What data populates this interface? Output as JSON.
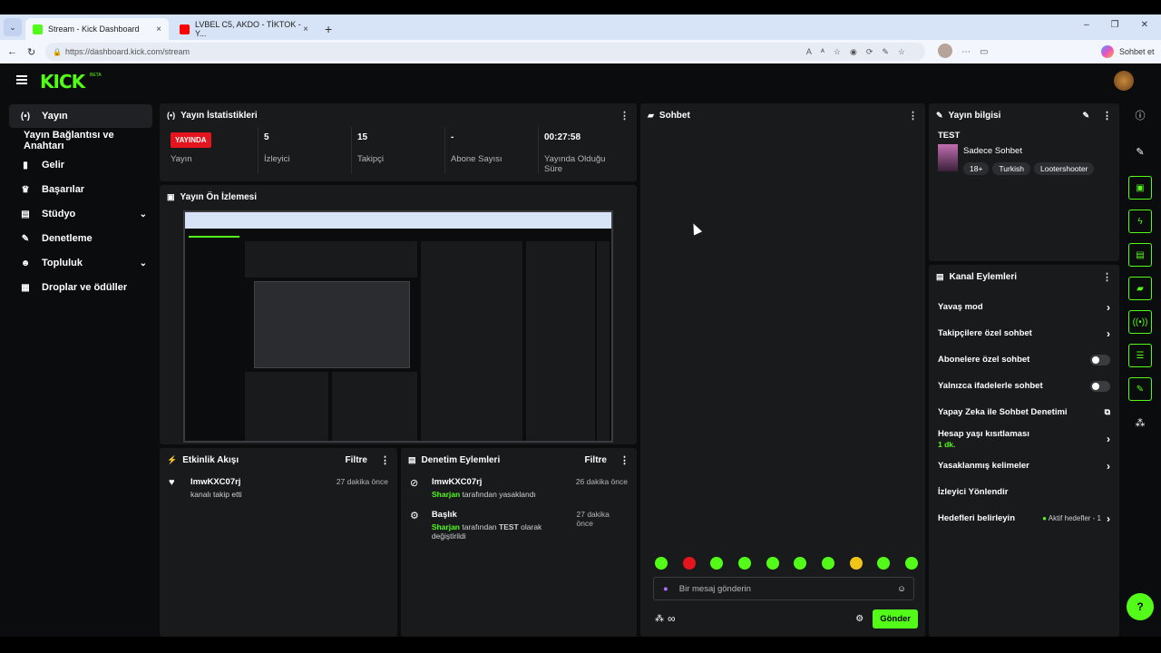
{
  "browser": {
    "tabs": [
      {
        "title": "Stream - Kick Dashboard",
        "close": "×"
      },
      {
        "title": "LVBEL C5, AKDO - TİKTOK - Y...",
        "close": "×"
      }
    ],
    "new_tab": "+",
    "url": "https://dashboard.kick.com/stream",
    "profile_label": "Sohbet et"
  },
  "app": {
    "logo": "KICK",
    "logo_badge": "BETA",
    "sidebar": [
      {
        "label": "Yayın",
        "icon": "live-icon"
      },
      {
        "label": "Yayın Bağlantısı ve Anahtarı",
        "icon": ""
      },
      {
        "label": "Gelir",
        "icon": "chart-icon"
      },
      {
        "label": "Başarılar",
        "icon": "trophy-icon"
      },
      {
        "label": "Stüdyo",
        "icon": "studio-icon",
        "expand": "⌄"
      },
      {
        "label": "Denetleme",
        "icon": "wrench-icon"
      },
      {
        "label": "Topluluk",
        "icon": "community-icon",
        "expand": "⌄"
      },
      {
        "label": "Droplar ve ödüller",
        "icon": "gift-icon"
      }
    ]
  },
  "stats": {
    "title": "Yayın İstatistikleri",
    "items": [
      {
        "value": "YAYINDA",
        "label": "Yayın"
      },
      {
        "value": "5",
        "label": "İzleyici"
      },
      {
        "value": "15",
        "label": "Takipçi"
      },
      {
        "value": "-",
        "label": "Abone Sayısı"
      },
      {
        "value": "00:27:58",
        "label": "Yayında Olduğu Süre"
      }
    ]
  },
  "preview": {
    "title": "Yayın Ön İzlemesi"
  },
  "activity": {
    "title": "Etkinlik Akışı",
    "filter": "Filtre",
    "items": [
      {
        "user": "ImwKXC07rj",
        "text": "kanalı takip etti",
        "time": "27 dakika önce"
      }
    ]
  },
  "mod": {
    "title": "Denetim Eylemleri",
    "filter": "Filtre",
    "items": [
      {
        "name": "ImwKXC07rj",
        "by": "Sharjan",
        "text": "tarafından yasaklandı",
        "time": "26 dakika önce"
      },
      {
        "name": "Başlık",
        "by": "Sharjan",
        "text_pre": "tarafından",
        "value": "TEST",
        "text_post": "olarak değiştirildi",
        "time": "27 dakika önce"
      }
    ]
  },
  "chat": {
    "title": "Sohbet",
    "placeholder": "Bir mesaj gönderin",
    "send": "Gönder",
    "infinity": "∞"
  },
  "info": {
    "title": "Yayın bilgisi",
    "stream_title": "TEST",
    "category": "Sadece Sohbet",
    "tags": [
      "18+",
      "Turkish",
      "Lootershooter"
    ]
  },
  "channel": {
    "title": "Kanal Eylemleri",
    "items": [
      {
        "label": "Yavaş mod",
        "type": "arrow"
      },
      {
        "label": "Takipçilere özel sohbet",
        "type": "arrow"
      },
      {
        "label": "Abonelere özel sohbet",
        "type": "toggle"
      },
      {
        "label": "Yalnızca ifadelerle sohbet",
        "type": "toggle"
      },
      {
        "label": "Yapay Zeka ile Sohbet Denetimi",
        "type": "external"
      },
      {
        "label": "Hesap yaşı kısıtlaması",
        "sub": "1 dk.",
        "type": "arrow"
      },
      {
        "label": "Yasaklanmış kelimeler",
        "type": "arrow"
      },
      {
        "label": "İzleyici Yönlendir",
        "type": "none"
      },
      {
        "label": "Hedefleri belirleyin",
        "sub_right": "Aktif hedefler - 1",
        "type": "arrow"
      }
    ]
  }
}
